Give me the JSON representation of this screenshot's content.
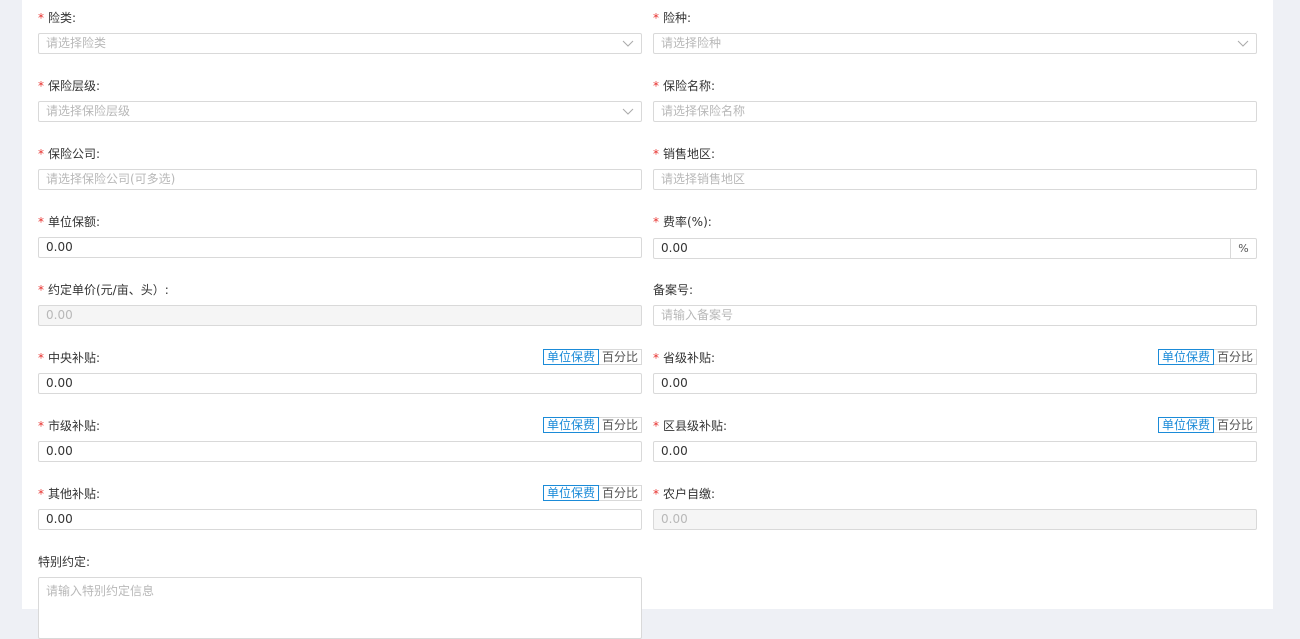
{
  "fields": {
    "insurance_category": {
      "label": "险类:",
      "placeholder": "请选择险类"
    },
    "insurance_type": {
      "label": "险种:",
      "placeholder": "请选择险种"
    },
    "insurance_level": {
      "label": "保险层级:",
      "placeholder": "请选择保险层级"
    },
    "insurance_name": {
      "label": "保险名称:",
      "placeholder": "请选择保险名称"
    },
    "insurance_company": {
      "label": "保险公司:",
      "placeholder": "请选择保险公司(可多选)"
    },
    "sales_region": {
      "label": "销售地区:",
      "placeholder": "请选择销售地区"
    },
    "unit_sum_insured": {
      "label": "单位保额:",
      "value": "0.00"
    },
    "rate": {
      "label": "费率(%):",
      "value": "0.00",
      "suffix": "%"
    },
    "agreed_unit_price": {
      "label": "约定单价(元/亩、头）:",
      "value": "0.00"
    },
    "filing_number": {
      "label": "备案号:",
      "placeholder": "请输入备案号"
    },
    "central_subsidy": {
      "label": "中央补贴:",
      "value": "0.00"
    },
    "provincial_subsidy": {
      "label": "省级补贴:",
      "value": "0.00"
    },
    "city_subsidy": {
      "label": "市级补贴:",
      "value": "0.00"
    },
    "county_subsidy": {
      "label": "区县级补贴:",
      "value": "0.00"
    },
    "other_subsidy": {
      "label": "其他补贴:",
      "value": "0.00"
    },
    "farmer_self_pay": {
      "label": "农户自缴:",
      "value": "0.00"
    },
    "special_agreement": {
      "label": "特别约定:",
      "placeholder": "请输入特别约定信息"
    }
  },
  "toggle": {
    "unit_premium": "单位保费",
    "percentage": "百分比"
  },
  "required_mark": "*",
  "colors": {
    "required": "#e8312e",
    "accent": "#1b8bd8",
    "border": "#d9d9d9",
    "placeholder": "#b8b8b8"
  },
  "icons": {
    "select_arrow": "chevron-down-icon"
  }
}
